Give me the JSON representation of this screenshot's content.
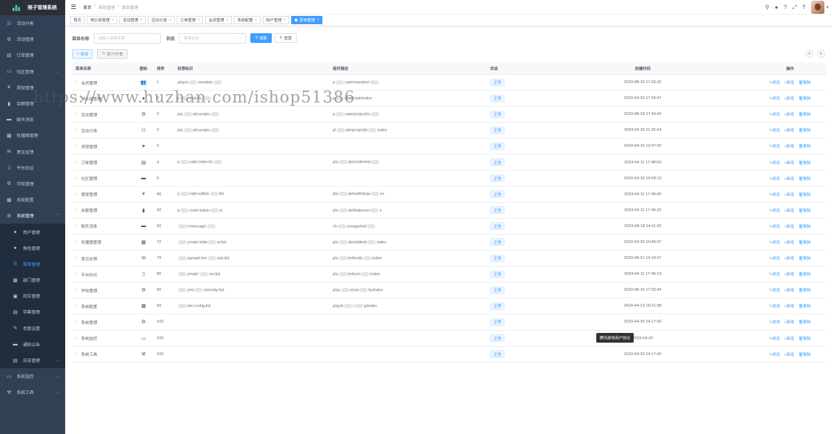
{
  "app": {
    "title": "陪子管理系统"
  },
  "sidebar": {
    "items": [
      {
        "label": "活动分类",
        "icon": "list-icon"
      },
      {
        "label": "活动管理",
        "icon": "gear-icon"
      },
      {
        "label": "订单管理",
        "icon": "document-icon"
      },
      {
        "label": "社区管理",
        "icon": "chat-icon"
      },
      {
        "label": "提现管理",
        "icon": "yen-icon"
      },
      {
        "label": "余额管理",
        "icon": "chart-icon"
      },
      {
        "label": "聊天消息",
        "icon": "message-icon"
      },
      {
        "label": "轮播图管理",
        "icon": "image-icon"
      },
      {
        "label": "意见反馈",
        "icon": "mail-icon"
      },
      {
        "label": "平台协议",
        "icon": "book-icon"
      },
      {
        "label": "学校管理",
        "icon": "gear-icon"
      },
      {
        "label": "系统配置",
        "icon": "config-icon"
      },
      {
        "label": "系统管理",
        "icon": "gear-icon"
      }
    ],
    "sub_items": [
      {
        "label": "用户管理",
        "icon": "user-icon"
      },
      {
        "label": "角色管理",
        "icon": "users-icon"
      },
      {
        "label": "菜单管理",
        "icon": "tree-icon"
      },
      {
        "label": "部门管理",
        "icon": "org-icon"
      },
      {
        "label": "岗位管理",
        "icon": "post-icon"
      },
      {
        "label": "字典管理",
        "icon": "dict-icon"
      },
      {
        "label": "参数设置",
        "icon": "edit-icon"
      },
      {
        "label": "通知公告",
        "icon": "message-icon"
      },
      {
        "label": "日志管理",
        "icon": "log-icon"
      }
    ],
    "bottom_items": [
      {
        "label": "系统监控",
        "icon": "monitor-icon"
      },
      {
        "label": "系统工具",
        "icon": "tool-icon"
      }
    ]
  },
  "header": {
    "breadcrumb": [
      "首页",
      "系统管理",
      "菜单管理"
    ],
    "separator": "/"
  },
  "tabs": [
    "首页",
    "俱乐部管理",
    "活动管理",
    "活动分类",
    "订单管理",
    "会员管理",
    "系统配置",
    "用户管理",
    "菜单管理"
  ],
  "search": {
    "name_label": "菜单名称",
    "name_placeholder": "请输入菜单名称",
    "status_label": "状态",
    "status_placeholder": "菜单状态",
    "search_btn": "搜索",
    "reset_btn": "重置"
  },
  "toolbar": {
    "add_label": "新增",
    "expand_label": "展开/折叠"
  },
  "table": {
    "headers": [
      "菜单名称",
      "图标",
      "排序",
      "权限标识",
      "组件路径",
      "状态",
      "创建时间",
      "操作"
    ],
    "op_edit": "修改",
    "op_add": "新增",
    "op_delete": "删除",
    "rows": [
      {
        "name": "会员管理",
        "icon": "user",
        "order": "1",
        "perm": "playm▒member▒",
        "path": "p▒nate/member/▒",
        "status": "正常",
        "time": "2023-08-16 17:32:32"
      },
      {
        "name": "俱乐部管理",
        "icon": "club",
        "order": "2",
        "perm": "p▒club:lis▒",
        "path": "p▒nate/club/index",
        "status": "正常",
        "time": "2024-03-20 17:15:47"
      },
      {
        "name": "活动管理",
        "icon": "gear",
        "order": "3",
        "perm": "pla▒ate:projec▒",
        "path": "p▒nate/project/in▒",
        "status": "正常",
        "time": "2023-08-18 17:43:43"
      },
      {
        "name": "活动分类",
        "icon": "list",
        "order": "3",
        "perm": "pla▒ate:projec▒",
        "path": "pl▒ate/projectte▒index",
        "status": "正常",
        "time": "2024-03-20 11:25:24"
      },
      {
        "name": "寻搭管理",
        "icon": "send",
        "order": "3",
        "perm": "",
        "path": "",
        "status": "正常",
        "time": "2024-04-16 13:47:02"
      },
      {
        "name": "订单管理",
        "icon": "doc",
        "order": "4",
        "perm": "p▒nate:order:lis▒",
        "path": "pla▒ate/order/ind▒",
        "status": "正常",
        "time": "2024-04-11 17:48:50"
      },
      {
        "name": "社区管理",
        "icon": "chat",
        "order": "5",
        "perm": "",
        "path": "",
        "status": "正常",
        "time": "2024-04-16 14:09:13"
      },
      {
        "name": "提现管理",
        "icon": "yen",
        "order": "40",
        "perm": "p▒nate:withdr▒list",
        "path": "pla▒ate/withdraw▒ex",
        "status": "正常",
        "time": "2024-04-11 17:49:45"
      },
      {
        "name": "余额管理",
        "icon": "chart",
        "order": "42",
        "perm": "p▒mate:balan▒st",
        "path": "pla▒ate/balance/▒x",
        "status": "正常",
        "time": "2024-04-11 17:49:33"
      },
      {
        "name": "聊天消息",
        "icon": "msg",
        "order": "50",
        "perm": "▒t:message:▒",
        "path": "ch▒essage/ind▒",
        "status": "正常",
        "time": "2023-08-18 14:11:33"
      },
      {
        "name": "轮播图管理",
        "icon": "image",
        "order": "72",
        "perm": "▒ymate:slide▒w:list",
        "path": "pla▒ate/slidesh▒index",
        "status": "正常",
        "time": "2024-03-20 10:46:07"
      },
      {
        "name": "意见反馈",
        "icon": "mail",
        "order": "79",
        "perm": "▒aymate:fee▒ack:list",
        "path": "pla▒te/feedb▒index",
        "status": "正常",
        "time": "2023-09-01 14:10:27"
      },
      {
        "name": "平台协议",
        "icon": "book",
        "order": "80",
        "perm": "▒ymate:▒ise:list",
        "path": "pla▒te/licen▒index",
        "status": "正常",
        "time": "2024-04-11 17:49:13"
      },
      {
        "name": "学校管理",
        "icon": "gear",
        "order": "90",
        "perm": "▒ymt▒niversity:list",
        "path": "play▒e/uni▒ity/index",
        "status": "正常",
        "time": "2023-08-16 17:32:44"
      },
      {
        "name": "系统配置",
        "icon": "config",
        "order": "99",
        "perm": "▒ate:config:list",
        "path": "playm▒/▒g/index",
        "status": "正常",
        "time": "2024-04-19 16:21:58"
      },
      {
        "name": "系统管理",
        "icon": "gear",
        "order": "100",
        "perm": "",
        "path": "",
        "status": "正常",
        "time": "2023-04-20 14:17:43"
      },
      {
        "name": "系统监控",
        "icon": "monitor",
        "order": "100",
        "perm": "",
        "path": "",
        "status": "正常",
        "time": "2023-04-20"
      },
      {
        "name": "系统工具",
        "icon": "tool",
        "order": "100",
        "perm": "",
        "path": "",
        "status": "正常",
        "time": "2023-04-20 14:17:43"
      }
    ]
  },
  "tooltip": "腾讯游戏用户协议",
  "watermark": "https://www.huzhan.com/ishop51386",
  "colors": {
    "primary": "#409eff",
    "sidebar": "#304156",
    "sidebar_sub": "#1f2d3d"
  }
}
